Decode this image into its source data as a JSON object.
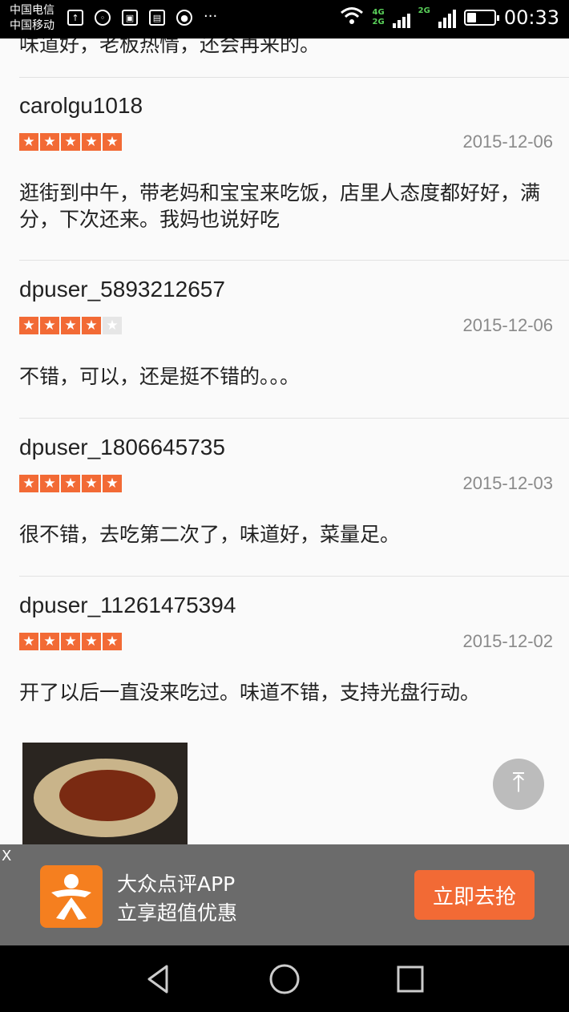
{
  "status_bar": {
    "carrier_1": "中国电信",
    "carrier_2": "中国移动",
    "net_1": "4G",
    "net_2": "2G",
    "net_3": "2G",
    "time": "00:33",
    "battery_level": 0.35
  },
  "partial_text": "味道好，老板热情，还会再来的。",
  "reviews": [
    {
      "user": "carolgu1018",
      "rating": 5,
      "date": "2015-12-06",
      "text": "逛街到中午，带老妈和宝宝来吃饭，店里人态度都好好，满分，下次还来。我妈也说好吃"
    },
    {
      "user": "dpuser_5893212657",
      "rating": 4,
      "date": "2015-12-06",
      "text": "不错，可以，还是挺不错的。。。"
    },
    {
      "user": "dpuser_1806645735",
      "rating": 5,
      "date": "2015-12-03",
      "text": "很不错，去吃第二次了，味道好，菜量足。"
    },
    {
      "user": "dpuser_11261475394",
      "rating": 5,
      "date": "2015-12-02",
      "text": "开了以后一直没来吃过。味道不错，支持光盘行动。"
    }
  ],
  "banner": {
    "close": "X",
    "app_name": "大众点评APP",
    "app_sub": "立享超值优惠",
    "cta": "立即去抢"
  },
  "colors": {
    "accent": "#f26a35",
    "star_off": "#e6e6e6",
    "banner_bg": "#6b6b6b"
  }
}
